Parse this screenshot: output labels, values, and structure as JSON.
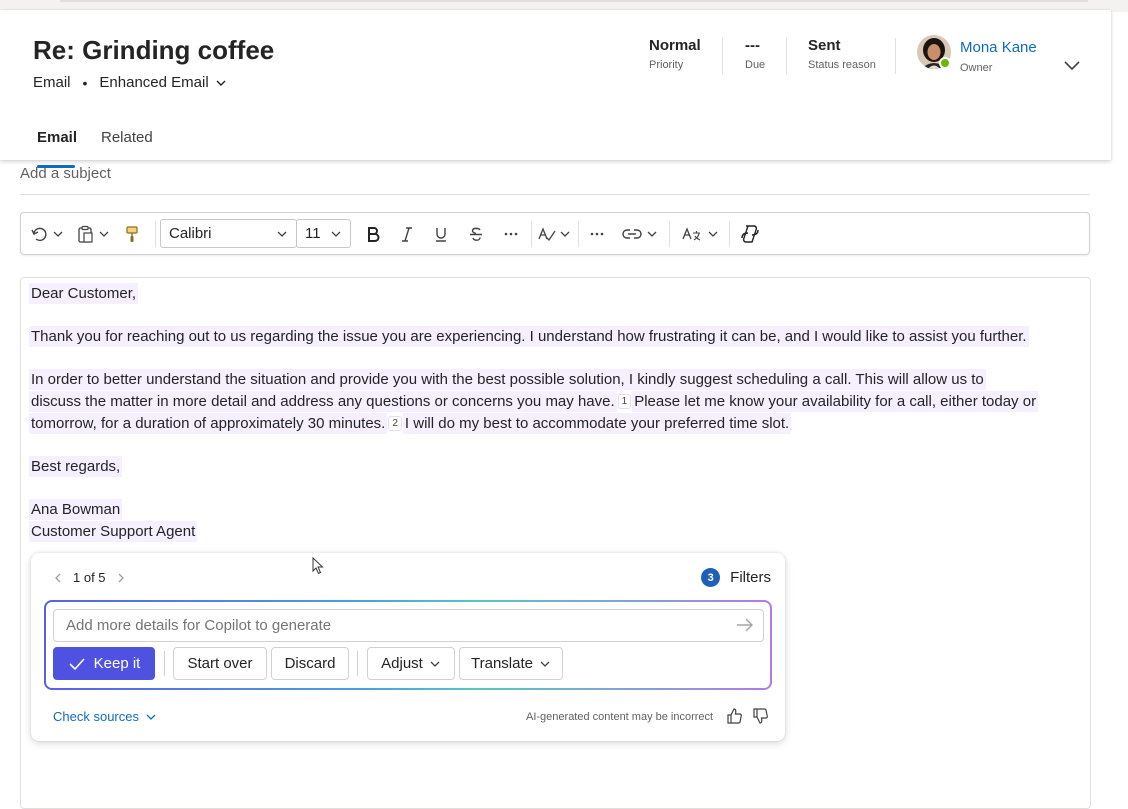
{
  "header": {
    "title": "Re: Grinding coffee",
    "entity": "Email",
    "separator": "•",
    "form": "Enhanced Email",
    "fields": [
      {
        "value": "Normal",
        "label": "Priority"
      },
      {
        "value": "---",
        "label": "Due"
      },
      {
        "value": "Sent",
        "label": "Status reason"
      }
    ],
    "owner": {
      "name": "Mona Kane",
      "label": "Owner"
    },
    "tabs": [
      {
        "label": "Email",
        "active": true
      },
      {
        "label": "Related",
        "active": false
      }
    ]
  },
  "subject": {
    "placeholder": "Add a subject"
  },
  "toolbar": {
    "font": "Calibri",
    "size": "11",
    "buttons": [
      "undo-icon",
      "clipboard-icon",
      "format-painter-icon",
      "bold-icon",
      "italic-icon",
      "underline-icon",
      "strikethrough-icon",
      "more-icon",
      "spelling-icon",
      "more-icon",
      "link-icon",
      "translate-icon",
      "copilot-icon"
    ]
  },
  "body": {
    "greeting": "Dear Customer,",
    "para1": "Thank you for reaching out to us regarding the issue you are experiencing. I understand how frustrating it can be, and I would like to assist you further.",
    "para2_line1": "In order to better understand the situation and provide you with the best possible solution, I kindly suggest scheduling a call. This will allow us to",
    "para2_line2a": "discuss the matter in more detail and address any questions or concerns you may have.",
    "cite1": "1",
    "para2_line2b": "Please let me know your availability for a call, either today or",
    "para2_line3a": "tomorrow, for a duration of approximately 30 minutes.",
    "cite2": "2",
    "para2_line3b": "I will do my best to accommodate your preferred time slot.",
    "closing": "Best regards,",
    "signature_name": "Ana Bowman",
    "signature_title": "Customer Support Agent"
  },
  "copilot": {
    "pager": "1 of 5",
    "filters_count": "3",
    "filters_label": "Filters",
    "input_placeholder": "Add more details for Copilot to generate",
    "buttons": {
      "keep": "Keep it",
      "start_over": "Start over",
      "discard": "Discard",
      "adjust": "Adjust",
      "translate": "Translate"
    },
    "check_sources": "Check sources",
    "disclaimer": "AI-generated content may be incorrect"
  },
  "colors": {
    "accent": "#0f6cbd",
    "primary_button": "#4f52e0",
    "highlight": "#f5efff",
    "presence": "#6bb700"
  }
}
